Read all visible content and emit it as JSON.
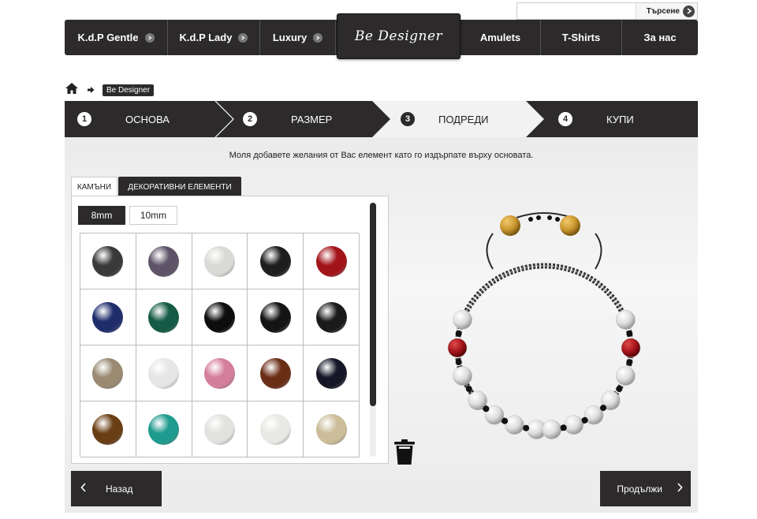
{
  "search": {
    "placeholder": "",
    "button_label": "Търсене"
  },
  "nav": {
    "items": [
      "K.d.P Gentle",
      "K.d.P Lady",
      "Luxury",
      "Amulets",
      "T-Shirts",
      "За нас"
    ],
    "logo_text": "Be Designer"
  },
  "breadcrumb": {
    "home_icon": "home-icon",
    "current": "Be Designer"
  },
  "steps": [
    {
      "num": "1",
      "label": "ОСНОВА"
    },
    {
      "num": "2",
      "label": "РАЗМЕР"
    },
    {
      "num": "3",
      "label": "ПОДРЕДИ"
    },
    {
      "num": "4",
      "label": "КУПИ"
    }
  ],
  "instruction": "Моля добавете желания от Вас елемент като го издърпате върху основата.",
  "tabs": {
    "stones": "КАМЪНИ",
    "decorative": "ДЕКОРАТИВНИ ЕЛЕМЕНТИ"
  },
  "sizes": {
    "s8": "8mm",
    "s10": "10mm"
  },
  "beads": [
    "#3a3a3a",
    "#5e5468",
    "#d9d9d6",
    "#1e1e1e",
    "#a3141a",
    "#1f2e6b",
    "#145a45",
    "#0d0d0d",
    "#141414",
    "#1a1a1a",
    "#9a8a72",
    "#e6e6e6",
    "#d47e9c",
    "#6a2e17",
    "#151726",
    "#6a3e15",
    "#1f9a8e",
    "#e1e1df",
    "#e8e8e4",
    "#cbbd99"
  ],
  "buttons": {
    "back": "Назад",
    "next": "Продължи"
  },
  "colors": {
    "dark": "#2c2a2a",
    "accent_red": "#a3141a",
    "gold": "#c9962e"
  }
}
